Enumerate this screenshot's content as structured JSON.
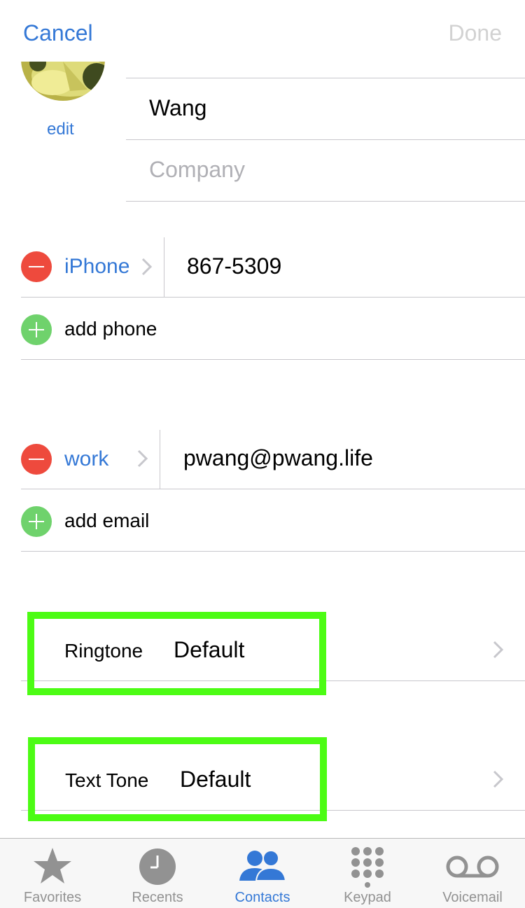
{
  "nav": {
    "cancel_label": "Cancel",
    "done_label": "Done"
  },
  "photo": {
    "edit_label": "edit"
  },
  "name": {
    "last_name": "Wang",
    "company_placeholder": "Company"
  },
  "phone": {
    "label": "iPhone",
    "value": "867-5309",
    "add_label": "add phone"
  },
  "email": {
    "label": "work",
    "value": "pwang@pwang.life",
    "add_label": "add email"
  },
  "ringtone": {
    "label": "Ringtone",
    "value": "Default"
  },
  "text_tone": {
    "label": "Text Tone",
    "value": "Default"
  },
  "tabbar": {
    "items": [
      {
        "label": "Favorites",
        "icon": "star-icon"
      },
      {
        "label": "Recents",
        "icon": "clock-icon"
      },
      {
        "label": "Contacts",
        "icon": "contacts-icon",
        "active": true
      },
      {
        "label": "Keypad",
        "icon": "keypad-icon"
      },
      {
        "label": "Voicemail",
        "icon": "voicemail-icon"
      }
    ]
  },
  "colors": {
    "accent": "#3478d6",
    "remove": "#ee4a3d",
    "add": "#6fd26c",
    "highlight": "#4cfc14",
    "done_disabled": "#d2d2d2"
  }
}
